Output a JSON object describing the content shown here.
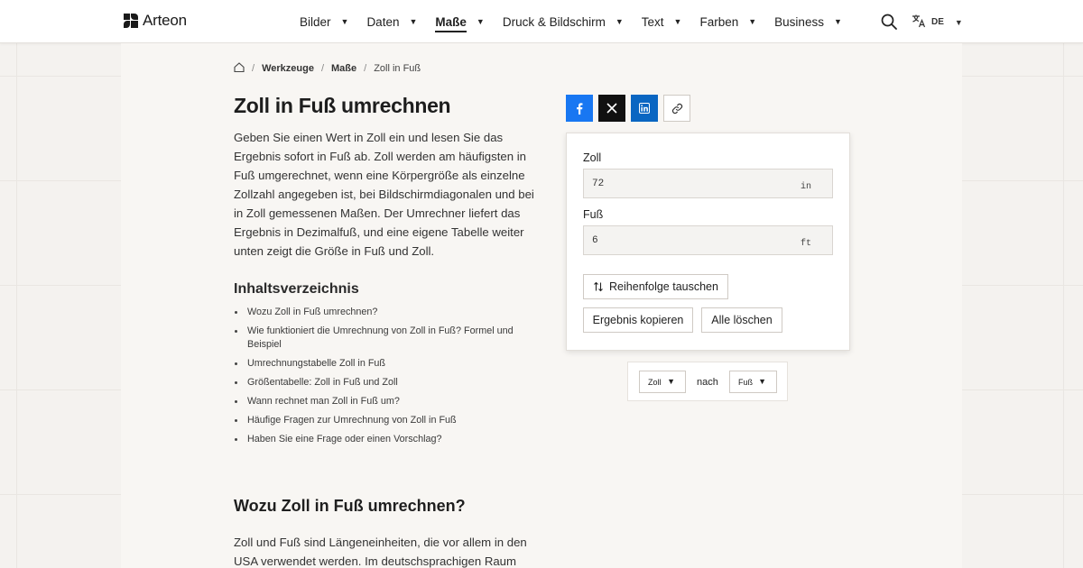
{
  "header": {
    "logo_text": "Arteon",
    "nav": [
      {
        "label": "Bilder",
        "active": false
      },
      {
        "label": "Daten",
        "active": false
      },
      {
        "label": "Maße",
        "active": true
      },
      {
        "label": "Druck & Bildschirm",
        "active": false
      },
      {
        "label": "Text",
        "active": false
      },
      {
        "label": "Farben",
        "active": false
      },
      {
        "label": "Business",
        "active": false
      }
    ],
    "caret": "▼",
    "language": "DE"
  },
  "breadcrumb": {
    "items": [
      "Werkzeuge",
      "Maße",
      "Zoll in Fuß"
    ],
    "separator": "/"
  },
  "page": {
    "title": "Zoll in Fuß umrechnen",
    "intro": "Geben Sie einen Wert in Zoll ein und lesen Sie das Ergebnis sofort in Fuß ab. Zoll werden am häufigsten in Fuß umgerechnet, wenn eine Körpergröße als einzelne Zollzahl angegeben ist, bei Bildschirmdiagonalen und bei in Zoll gemessenen Maßen. Der Umrechner liefert das Ergebnis in Dezimalfuß, und eine eigene Tabelle weiter unten zeigt die Größe in Fuß und Zoll.",
    "toc_title": "Inhaltsverzeichnis",
    "toc": [
      "Wozu Zoll in Fuß umrechnen?",
      "Wie funktioniert die Umrechnung von Zoll in Fuß? Formel und Beispiel",
      "Umrechnungstabelle Zoll in Fuß",
      "Größentabelle: Zoll in Fuß und Zoll",
      "Wann rechnet man Zoll in Fuß um?",
      "Häufige Fragen zur Umrechnung von Zoll in Fuß",
      "Haben Sie eine Frage oder einen Vorschlag?"
    ],
    "section_title": "Wozu Zoll in Fuß umrechnen?",
    "section_text": "Zoll und Fuß sind Längeneinheiten, die vor allem in den USA verwendet werden. Im deutschsprachigen Raum"
  },
  "converter": {
    "from_label": "Zoll",
    "from_value": "72",
    "from_unit": "in",
    "to_label": "Fuß",
    "to_value": "6",
    "to_unit": "ft",
    "swap_label": "Reihenfolge tauschen",
    "copy_label": "Ergebnis kopieren",
    "clear_label": "Alle löschen"
  },
  "unit_switch": {
    "from": "Zoll",
    "connector": "nach",
    "to": "Fuß"
  },
  "colors": {
    "facebook": "#1877f2",
    "x": "#111111",
    "linkedin": "#0a66c2"
  }
}
